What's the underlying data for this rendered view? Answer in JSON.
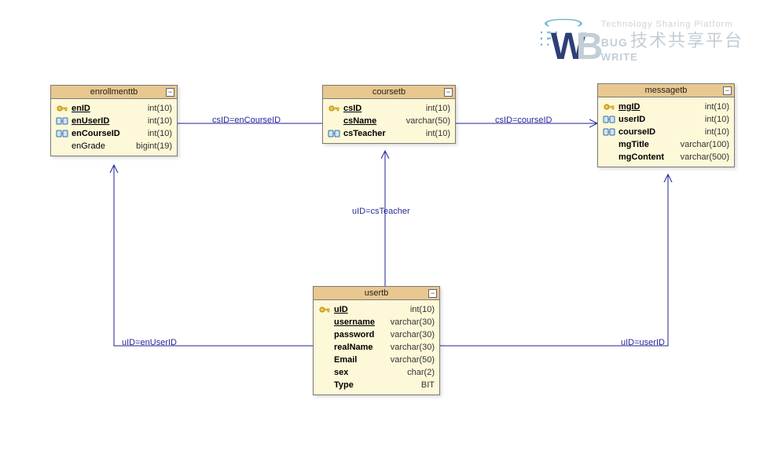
{
  "watermark": {
    "tagline": "Technology Sharing Platform",
    "bug": "BUG",
    "write": "WRITE",
    "cn": "技术共享平台"
  },
  "tables": {
    "enrollmenttb": {
      "title": "enrollmenttb",
      "columns": [
        {
          "icon": "pk",
          "name": "enID",
          "type": "int(10)",
          "style": "pk"
        },
        {
          "icon": "fk",
          "name": "enUserID",
          "type": "int(10)",
          "style": "fk"
        },
        {
          "icon": "fk",
          "name": "enCourseID",
          "type": "int(10)",
          "style": "bold"
        },
        {
          "icon": "",
          "name": "enGrade",
          "type": "bigint(19)",
          "style": ""
        }
      ]
    },
    "coursetb": {
      "title": "coursetb",
      "columns": [
        {
          "icon": "pk",
          "name": "csID",
          "type": "int(10)",
          "style": "pk"
        },
        {
          "icon": "",
          "name": "csName",
          "type": "varchar(50)",
          "style": "fk"
        },
        {
          "icon": "fk",
          "name": "csTeacher",
          "type": "int(10)",
          "style": "bold"
        }
      ]
    },
    "messagetb": {
      "title": "messagetb",
      "columns": [
        {
          "icon": "pk",
          "name": "mgID",
          "type": "int(10)",
          "style": "pk"
        },
        {
          "icon": "fk",
          "name": "userID",
          "type": "int(10)",
          "style": "bold"
        },
        {
          "icon": "fk",
          "name": "courseID",
          "type": "int(10)",
          "style": "bold"
        },
        {
          "icon": "",
          "name": "mgTitle",
          "type": "varchar(100)",
          "style": "bold"
        },
        {
          "icon": "",
          "name": "mgContent",
          "type": "varchar(500)",
          "style": "bold"
        }
      ]
    },
    "usertb": {
      "title": "usertb",
      "columns": [
        {
          "icon": "pk",
          "name": "uID",
          "type": "int(10)",
          "style": "pk"
        },
        {
          "icon": "",
          "name": "username",
          "type": "varchar(30)",
          "style": "fk"
        },
        {
          "icon": "",
          "name": "password",
          "type": "varchar(30)",
          "style": "bold"
        },
        {
          "icon": "",
          "name": "realName",
          "type": "varchar(30)",
          "style": "bold"
        },
        {
          "icon": "",
          "name": "Email",
          "type": "varchar(50)",
          "style": "bold"
        },
        {
          "icon": "",
          "name": "sex",
          "type": "char(2)",
          "style": "bold"
        },
        {
          "icon": "",
          "name": "Type",
          "type": "BIT",
          "style": "bold"
        }
      ]
    }
  },
  "relations": {
    "csID_enCourseID": "csID=enCourseID",
    "csID_courseID": "csID=courseID",
    "uID_csTeacher": "uID=csTeacher",
    "uID_enUserID": "uID=enUserID",
    "uID_userID": "uID=userID"
  },
  "chart_data": {
    "type": "diagram",
    "description": "Entity-Relationship database schema diagram",
    "entities": [
      {
        "name": "enrollmenttb",
        "columns": [
          {
            "name": "enID",
            "type": "int(10)",
            "pk": true
          },
          {
            "name": "enUserID",
            "type": "int(10)",
            "fk": true
          },
          {
            "name": "enCourseID",
            "type": "int(10)",
            "fk": true
          },
          {
            "name": "enGrade",
            "type": "bigint(19)"
          }
        ]
      },
      {
        "name": "coursetb",
        "columns": [
          {
            "name": "csID",
            "type": "int(10)",
            "pk": true
          },
          {
            "name": "csName",
            "type": "varchar(50)"
          },
          {
            "name": "csTeacher",
            "type": "int(10)",
            "fk": true
          }
        ]
      },
      {
        "name": "messagetb",
        "columns": [
          {
            "name": "mgID",
            "type": "int(10)",
            "pk": true
          },
          {
            "name": "userID",
            "type": "int(10)",
            "fk": true
          },
          {
            "name": "courseID",
            "type": "int(10)",
            "fk": true
          },
          {
            "name": "mgTitle",
            "type": "varchar(100)"
          },
          {
            "name": "mgContent",
            "type": "varchar(500)"
          }
        ]
      },
      {
        "name": "usertb",
        "columns": [
          {
            "name": "uID",
            "type": "int(10)",
            "pk": true
          },
          {
            "name": "username",
            "type": "varchar(30)"
          },
          {
            "name": "password",
            "type": "varchar(30)"
          },
          {
            "name": "realName",
            "type": "varchar(30)"
          },
          {
            "name": "Email",
            "type": "varchar(50)"
          },
          {
            "name": "sex",
            "type": "char(2)"
          },
          {
            "name": "Type",
            "type": "BIT"
          }
        ]
      }
    ],
    "relationships": [
      {
        "from": "coursetb.csID",
        "to": "enrollmenttb.enCourseID",
        "label": "csID=enCourseID"
      },
      {
        "from": "coursetb.csID",
        "to": "messagetb.courseID",
        "label": "csID=courseID"
      },
      {
        "from": "usertb.uID",
        "to": "coursetb.csTeacher",
        "label": "uID=csTeacher"
      },
      {
        "from": "usertb.uID",
        "to": "enrollmenttb.enUserID",
        "label": "uID=enUserID"
      },
      {
        "from": "usertb.uID",
        "to": "messagetb.userID",
        "label": "uID=userID"
      }
    ]
  }
}
